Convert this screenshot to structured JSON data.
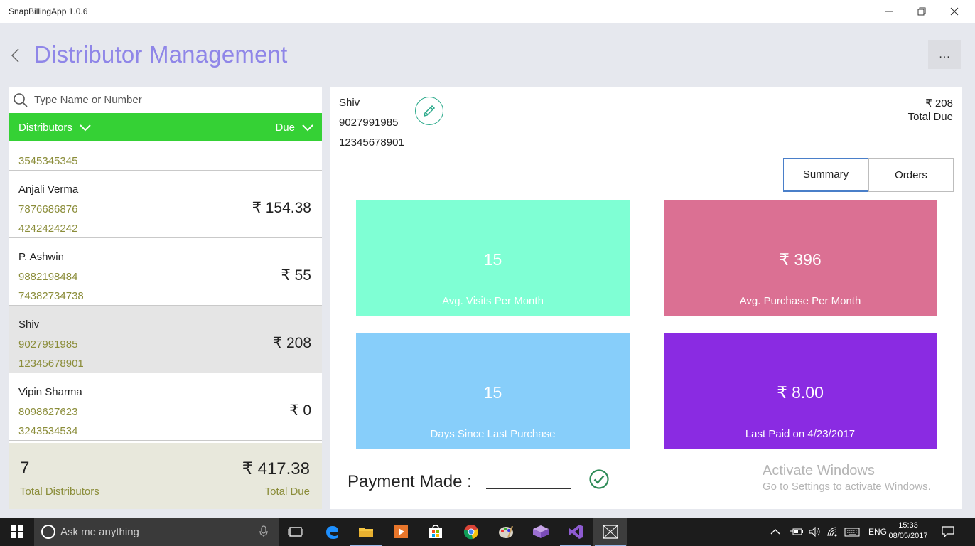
{
  "window": {
    "title": "SnapBillingApp 1.0.6"
  },
  "header": {
    "title": "Distributor Management",
    "more_label": "..."
  },
  "search": {
    "placeholder": "Type Name or Number"
  },
  "list_header": {
    "left_label": "Distributors",
    "right_label": "Due"
  },
  "partial_row": {
    "phone2": "3545345345"
  },
  "distributors": [
    {
      "name": "Anjali Verma",
      "phone1": "7876686876",
      "phone2": "4242424242",
      "due": "₹ 154.38"
    },
    {
      "name": "P. Ashwin",
      "phone1": "9882198484",
      "phone2": "74382734738",
      "due": "₹ 55"
    },
    {
      "name": "Shiv",
      "phone1": "9027991985",
      "phone2": "12345678901",
      "due": "₹ 208"
    },
    {
      "name": "Vipin Sharma",
      "phone1": "8098627623",
      "phone2": "3243534534",
      "due": "₹ 0"
    }
  ],
  "footer": {
    "count": "7",
    "count_label": "Total Distributors",
    "total": "₹ 417.38",
    "total_label": "Total Due"
  },
  "detail": {
    "name": "Shiv",
    "phone1": "9027991985",
    "phone2": "12345678901",
    "due": "₹ 208",
    "due_label": "Total Due",
    "tabs": [
      "Summary",
      "Orders"
    ],
    "cards": [
      {
        "value": "15",
        "label": "Avg. Visits Per Month",
        "color": "#7fffd4"
      },
      {
        "value": "₹ 396",
        "label": "Avg. Purchase Per Month",
        "color": "#db7093"
      },
      {
        "value": "15",
        "label": "Days Since Last Purchase",
        "color": "#87cefa"
      },
      {
        "value": "₹ 8.00",
        "label": "Last Paid on  4/23/2017",
        "color": "#8a2be2"
      }
    ],
    "payment_label": "Payment Made :"
  },
  "watermark": {
    "title": "Activate Windows",
    "subtitle": "Go to Settings to activate Windows."
  },
  "taskbar": {
    "search_placeholder": "Ask me anything",
    "language": "ENG",
    "time": "15:33",
    "date": "08/05/2017"
  },
  "colors": {
    "accent": "#8f86e8",
    "list_header": "#35d135",
    "phone_text": "#8b8d3a"
  }
}
